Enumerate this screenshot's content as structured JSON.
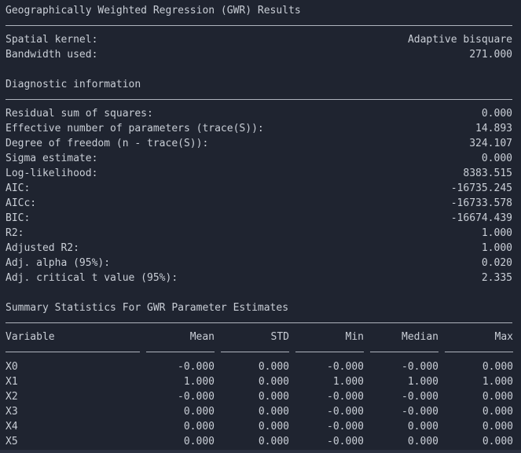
{
  "title": "Geographically Weighted Regression (GWR) Results",
  "model": [
    {
      "label": "Spatial kernel:",
      "value": "Adaptive bisquare"
    },
    {
      "label": "Bandwidth used:",
      "value": "271.000"
    }
  ],
  "diagnostic_title": "Diagnostic information",
  "diagnostics": [
    {
      "label": "Residual sum of squares:",
      "value": "0.000"
    },
    {
      "label": "Effective number of parameters (trace(S)):",
      "value": "14.893"
    },
    {
      "label": "Degree of freedom (n - trace(S)):",
      "value": "324.107"
    },
    {
      "label": "Sigma estimate:",
      "value": "0.000"
    },
    {
      "label": "Log-likelihood:",
      "value": "8383.515"
    },
    {
      "label": "AIC:",
      "value": "-16735.245"
    },
    {
      "label": "AICc:",
      "value": "-16733.578"
    },
    {
      "label": "BIC:",
      "value": "-16674.439"
    },
    {
      "label": "R2:",
      "value": "1.000"
    },
    {
      "label": "Adjusted R2:",
      "value": "1.000"
    },
    {
      "label": "Adj. alpha (95%):",
      "value": "0.020"
    },
    {
      "label": "Adj. critical t value (95%):",
      "value": "2.335"
    }
  ],
  "summary_title": "Summary Statistics For GWR Parameter Estimates",
  "columns": [
    "Variable",
    "Mean",
    "STD",
    "Min",
    "Median",
    "Max"
  ],
  "rows": [
    [
      "X0",
      "-0.000",
      "0.000",
      "-0.000",
      "-0.000",
      "0.000"
    ],
    [
      "X1",
      "1.000",
      "0.000",
      "1.000",
      "1.000",
      "1.000"
    ],
    [
      "X2",
      "-0.000",
      "0.000",
      "-0.000",
      "-0.000",
      "0.000"
    ],
    [
      "X3",
      "0.000",
      "0.000",
      "-0.000",
      "-0.000",
      "0.000"
    ],
    [
      "X4",
      "0.000",
      "0.000",
      "-0.000",
      "0.000",
      "0.000"
    ],
    [
      "X5",
      "0.000",
      "0.000",
      "-0.000",
      "0.000",
      "0.000"
    ]
  ]
}
